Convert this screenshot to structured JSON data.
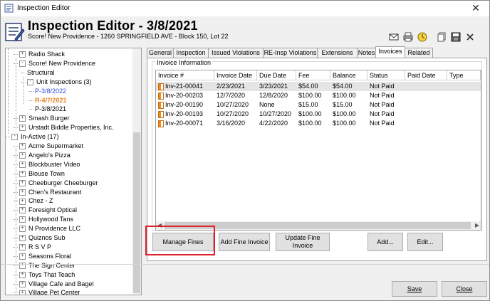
{
  "window": {
    "title": "Inspection Editor",
    "close_glyph": "✕"
  },
  "header": {
    "title": "Inspection Editor - 3/8/2021",
    "subtitle": "Score! New Providence - 1260 SPRINGFIELD AVE - Block 150, Lot 22",
    "icons": [
      "mail-icon",
      "print-icon",
      "clock-icon",
      "copy-icon",
      "save-icon",
      "delete-icon"
    ]
  },
  "tree": {
    "items": [
      {
        "label": "Radio Shack",
        "expander": "+"
      },
      {
        "label": "Score! New Providence",
        "expander": "-"
      },
      {
        "label": "Structural"
      },
      {
        "label": "Unit Inspections (3)",
        "expander": "-"
      },
      {
        "label": "P-3/8/2022",
        "color": "#2e4fd6"
      },
      {
        "label": "R-4/7/2021",
        "color": "#e8821e",
        "bold": true
      },
      {
        "label": "P-3/8/2021"
      },
      {
        "label": "Smash Burger",
        "expander": "+"
      },
      {
        "label": "Urstadt Biddle Properties, Inc.",
        "expander": "+"
      },
      {
        "label": "In-Active (17)",
        "expander": "-"
      },
      {
        "label": "Acme Supermarket",
        "expander": "+"
      },
      {
        "label": "Angelo's Pizza",
        "expander": "+"
      },
      {
        "label": "Blockbuster Video",
        "expander": "+"
      },
      {
        "label": "Blouse Town",
        "expander": "+"
      },
      {
        "label": "Cheeburger Cheeburger",
        "expander": "+"
      },
      {
        "label": "Chen's Restaurant",
        "expander": "+"
      },
      {
        "label": "Chez - Z",
        "expander": "+"
      },
      {
        "label": "Foresight Optical",
        "expander": "+"
      },
      {
        "label": "Hollywood Tans",
        "expander": "+"
      },
      {
        "label": "N Providence LLC",
        "expander": "+"
      },
      {
        "label": "Quiznos Sub",
        "expander": "+"
      },
      {
        "label": "R S V P",
        "expander": "+"
      },
      {
        "label": "Seasons Floral",
        "expander": "+"
      },
      {
        "label": "The Sign Center",
        "expander": "+"
      },
      {
        "label": "Toys That Teach",
        "expander": "+"
      },
      {
        "label": "Village Cafe and Bagel",
        "expander": "+"
      },
      {
        "label": "Village Pet Center",
        "expander": "+"
      }
    ]
  },
  "tabs": [
    "General",
    "Inspection",
    "Issued Violations",
    "RE-Insp Violations",
    "Extensions",
    "Notes",
    "Invoices",
    "Related"
  ],
  "active_tab": "Invoices",
  "invoices": {
    "group_label": "Invoice Information",
    "columns": [
      "Invoice #",
      "Invoice Date",
      "Due Date",
      "Fee",
      "Balance",
      "Status",
      "Paid Date",
      "Type"
    ],
    "rows": [
      [
        "Inv-21-00041",
        "2/23/2021",
        "3/23/2021",
        "$54.00",
        "$54.00",
        "Not Paid",
        "",
        ""
      ],
      [
        "Inv-20-00203",
        "12/7/2020",
        "12/8/2020",
        "$100.00",
        "$100.00",
        "Not Paid",
        "",
        ""
      ],
      [
        "Inv-20-00190",
        "10/27/2020",
        "None",
        "$15.00",
        "$15.00",
        "Not Paid",
        "",
        ""
      ],
      [
        "Inv-20-00193",
        "10/27/2020",
        "10/27/2020",
        "$100.00",
        "$100.00",
        "Not Paid",
        "",
        ""
      ],
      [
        "Inv-20-00071",
        "3/16/2020",
        "4/22/2020",
        "$100.00",
        "$100.00",
        "Not Paid",
        "",
        ""
      ]
    ],
    "selected_row": 0
  },
  "buttons": {
    "manage_fines": "Manage Fines",
    "add_fine_invoice": "Add Fine Invoice",
    "update_fine_invoice": "Update Fine Invoice",
    "add": "Add...",
    "edit": "Edit...",
    "save": "Save",
    "close": "Close"
  },
  "colors": {
    "highlight": "#e0202a",
    "link_blue": "#2e4fd6",
    "accent_orange": "#e8821e"
  }
}
